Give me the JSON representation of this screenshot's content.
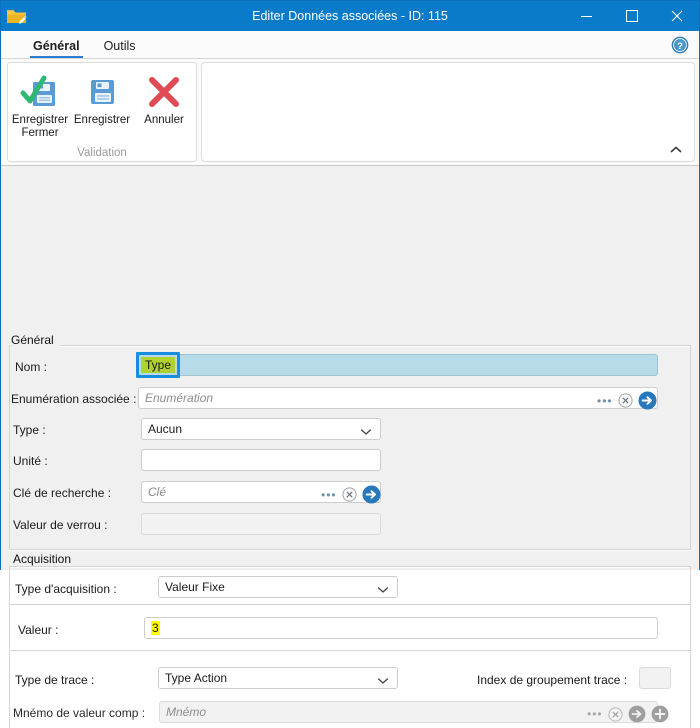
{
  "window": {
    "title": "Editer Données associées - ID: 115",
    "icon": "folder-edit-icon",
    "minimize_label": "Minimiser",
    "maximize_label": "Agrandir",
    "close_label": "Fermer",
    "titlebar_color": "#0a7bc8"
  },
  "ribbon": {
    "tabs": [
      {
        "label": "Général",
        "active": true
      },
      {
        "label": "Outils",
        "active": false
      }
    ],
    "help_icon": "help-circle-icon",
    "collapse_icon": "chevron-up-icon",
    "groups": [
      {
        "label": "Validation",
        "buttons": [
          {
            "label": "Enregistrer\nFermer",
            "label_line1": "Enregistrer",
            "label_line2": "Fermer",
            "icon": "save-and-close-icon"
          },
          {
            "label": "Enregistrer",
            "label_line1": "Enregistrer",
            "label_line2": "",
            "icon": "save-icon"
          },
          {
            "label": "Annuler",
            "label_line1": "Annuler",
            "label_line2": "",
            "icon": "cancel-cross-icon"
          }
        ]
      }
    ]
  },
  "sections": {
    "general": {
      "title": "Général",
      "fields": {
        "nom": {
          "label": "Nom :",
          "value": "Type",
          "highlight": "#b0d131",
          "focus_color": "#1b8de0",
          "field_bg": "#b7dbe8"
        },
        "enumeration": {
          "label": "Enumération associée :",
          "value": "",
          "placeholder": "Enumération",
          "icons": [
            "ellipsis-icon",
            "clear-circle-icon",
            "go-arrow-icon"
          ]
        },
        "type": {
          "label": "Type :",
          "value": "Aucun",
          "options": [
            "Aucun"
          ]
        },
        "unite": {
          "label": "Unité :",
          "value": ""
        },
        "cle_recherche": {
          "label": "Clé de recherche :",
          "value": "",
          "placeholder": "Clé",
          "icons": [
            "ellipsis-icon",
            "clear-circle-icon",
            "go-arrow-icon"
          ]
        },
        "valeur_verrou": {
          "label": "Valeur de verrou :",
          "value": "",
          "disabled": true
        }
      }
    },
    "acquisition": {
      "title": "Acquisition",
      "fields": {
        "type_acquisition": {
          "label": "Type d'acquisition :",
          "value": "Valeur Fixe",
          "highlight": "#ffff00",
          "options": [
            "Valeur Fixe"
          ]
        },
        "valeur": {
          "label": "Valeur :",
          "value": "3",
          "highlight": "#ffff00"
        },
        "type_trace": {
          "label": "Type de trace :",
          "value": "Type Action",
          "highlight": "#ffff00",
          "options": [
            "Type Action"
          ]
        },
        "index_groupement": {
          "label": "Index de groupement trace :",
          "value": ""
        },
        "mnemo": {
          "label": "Mnémo de valeur comp :",
          "value": "",
          "placeholder": "Mnémo",
          "disabled": true,
          "icons": [
            "ellipsis-icon",
            "clear-circle-icon",
            "go-arrow-icon",
            "add-circle-icon"
          ]
        }
      }
    }
  }
}
